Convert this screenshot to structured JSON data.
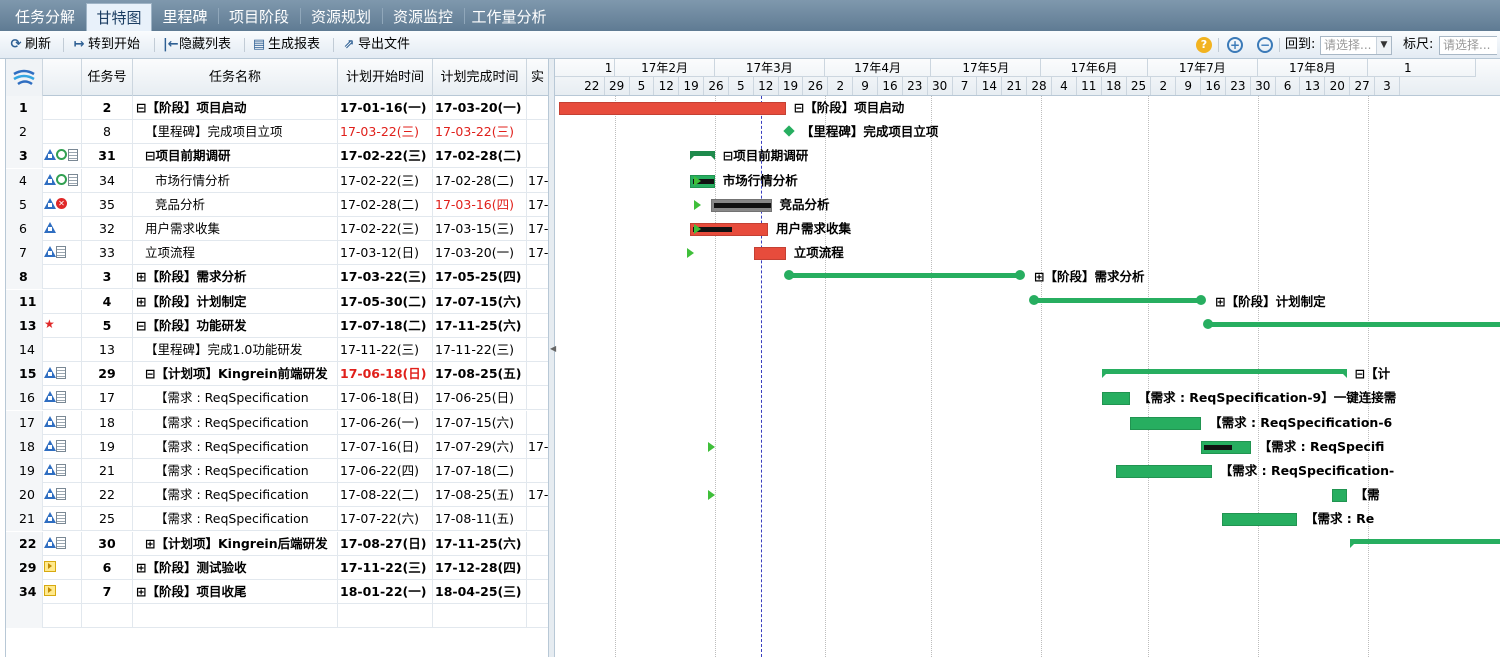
{
  "tabs": [
    "任务分解",
    "甘特图",
    "里程碑",
    "项目阶段",
    "资源规划",
    "资源监控",
    "工作量分析"
  ],
  "toolbar": {
    "refresh": "刷新",
    "goto_start": "转到开始",
    "hide_list": "隐藏列表",
    "gen_report": "生成报表",
    "export": "导出文件",
    "revert_label": "回到:",
    "revert_placeholder": "请选择...",
    "ruler_label": "标尺:",
    "ruler_placeholder": "请选择..."
  },
  "grid": {
    "columns": [
      "任务号",
      "任务名称",
      "计划开始时间",
      "计划完成时间",
      "实"
    ],
    "rows": [
      {
        "row": "1",
        "icons": [],
        "task_no": "2",
        "name": "⊟【阶段】项目启动",
        "start": "17-01-16(一)",
        "end": "17-03-20(一)",
        "actual": "",
        "bold": true,
        "indent": 0,
        "start_red": false,
        "end_red": false
      },
      {
        "row": "2",
        "icons": [],
        "task_no": "8",
        "name": "【里程碑】完成项目立项",
        "start": "17-03-22(三)",
        "end": "17-03-22(三)",
        "actual": "",
        "bold": false,
        "indent": 1,
        "start_red": true,
        "end_red": true
      },
      {
        "row": "3",
        "icons": [
          "a",
          "c",
          "d"
        ],
        "task_no": "31",
        "name": "⊟项目前期调研",
        "start": "17-02-22(三)",
        "end": "17-02-28(二)",
        "actual": "",
        "bold": true,
        "indent": 1,
        "start_red": false,
        "end_red": false
      },
      {
        "row": "4",
        "icons": [
          "a",
          "c",
          "d"
        ],
        "task_no": "34",
        "name": "市场行情分析",
        "start": "17-02-22(三)",
        "end": "17-02-28(二)",
        "actual": "17-",
        "bold": false,
        "indent": 2,
        "start_red": false,
        "end_red": false
      },
      {
        "row": "5",
        "icons": [
          "a",
          "x"
        ],
        "task_no": "35",
        "name": "竞品分析",
        "start": "17-02-28(二)",
        "end": "17-03-16(四)",
        "actual": "17-",
        "bold": false,
        "indent": 2,
        "start_red": false,
        "end_red": true
      },
      {
        "row": "6",
        "icons": [
          "a"
        ],
        "task_no": "32",
        "name": "用户需求收集",
        "start": "17-02-22(三)",
        "end": "17-03-15(三)",
        "actual": "17-",
        "bold": false,
        "indent": 1,
        "start_red": false,
        "end_red": false
      },
      {
        "row": "7",
        "icons": [
          "a",
          "d"
        ],
        "task_no": "33",
        "name": "立项流程",
        "start": "17-03-12(日)",
        "end": "17-03-20(一)",
        "actual": "17-",
        "bold": false,
        "indent": 1,
        "start_red": false,
        "end_red": false
      },
      {
        "row": "8",
        "icons": [],
        "task_no": "3",
        "name": "⊞【阶段】需求分析",
        "start": "17-03-22(三)",
        "end": "17-05-25(四)",
        "actual": "",
        "bold": true,
        "indent": 0,
        "start_red": false,
        "end_red": false
      },
      {
        "row": "11",
        "icons": [],
        "task_no": "4",
        "name": "⊞【阶段】计划制定",
        "start": "17-05-30(二)",
        "end": "17-07-15(六)",
        "actual": "",
        "bold": true,
        "indent": 0,
        "start_red": false,
        "end_red": false
      },
      {
        "row": "13",
        "icons": [
          "s"
        ],
        "task_no": "5",
        "name": "⊟【阶段】功能研发",
        "start": "17-07-18(二)",
        "end": "17-11-25(六)",
        "actual": "",
        "bold": true,
        "indent": 0,
        "start_red": false,
        "end_red": false
      },
      {
        "row": "14",
        "icons": [],
        "task_no": "13",
        "name": "【里程碑】完成1.0功能研发",
        "start": "17-11-22(三)",
        "end": "17-11-22(三)",
        "actual": "",
        "bold": false,
        "indent": 1,
        "start_red": false,
        "end_red": false
      },
      {
        "row": "15",
        "icons": [
          "a",
          "d"
        ],
        "task_no": "29",
        "name": "⊟【计划项】Kingrein前端研发",
        "start": "17-06-18(日)",
        "end": "17-08-25(五)",
        "actual": "",
        "bold": true,
        "indent": 1,
        "start_red": true,
        "end_red": false
      },
      {
        "row": "16",
        "icons": [
          "a",
          "d"
        ],
        "task_no": "17",
        "name": "【需求 : ReqSpecification",
        "start": "17-06-18(日)",
        "end": "17-06-25(日)",
        "actual": "",
        "bold": false,
        "indent": 2,
        "start_red": false,
        "end_red": false
      },
      {
        "row": "17",
        "icons": [
          "a",
          "d"
        ],
        "task_no": "18",
        "name": "【需求 : ReqSpecification",
        "start": "17-06-26(一)",
        "end": "17-07-15(六)",
        "actual": "",
        "bold": false,
        "indent": 2,
        "start_red": false,
        "end_red": false
      },
      {
        "row": "18",
        "icons": [
          "a",
          "d"
        ],
        "task_no": "19",
        "name": "【需求 : ReqSpecification",
        "start": "17-07-16(日)",
        "end": "17-07-29(六)",
        "actual": "17-",
        "bold": false,
        "indent": 2,
        "start_red": false,
        "end_red": false
      },
      {
        "row": "19",
        "icons": [
          "a",
          "d"
        ],
        "task_no": "21",
        "name": "【需求 : ReqSpecification",
        "start": "17-06-22(四)",
        "end": "17-07-18(二)",
        "actual": "",
        "bold": false,
        "indent": 2,
        "start_red": false,
        "end_red": false
      },
      {
        "row": "20",
        "icons": [
          "a",
          "d"
        ],
        "task_no": "22",
        "name": "【需求 : ReqSpecification",
        "start": "17-08-22(二)",
        "end": "17-08-25(五)",
        "actual": "17-",
        "bold": false,
        "indent": 2,
        "start_red": false,
        "end_red": false
      },
      {
        "row": "21",
        "icons": [
          "a",
          "d"
        ],
        "task_no": "25",
        "name": "【需求 : ReqSpecification",
        "start": "17-07-22(六)",
        "end": "17-08-11(五)",
        "actual": "",
        "bold": false,
        "indent": 2,
        "start_red": false,
        "end_red": false
      },
      {
        "row": "22",
        "icons": [
          "a",
          "d"
        ],
        "task_no": "30",
        "name": "⊞【计划项】Kingrein后端研发",
        "start": "17-08-27(日)",
        "end": "17-11-25(六)",
        "actual": "",
        "bold": true,
        "indent": 1,
        "start_red": false,
        "end_red": false
      },
      {
        "row": "29",
        "icons": [
          "p"
        ],
        "task_no": "6",
        "name": "⊞【阶段】测试验收",
        "start": "17-11-22(三)",
        "end": "17-12-28(四)",
        "actual": "",
        "bold": true,
        "indent": 0,
        "start_red": false,
        "end_red": false
      },
      {
        "row": "34",
        "icons": [
          "p"
        ],
        "task_no": "7",
        "name": "⊞【阶段】项目收尾",
        "start": "18-01-22(一)",
        "end": "18-04-25(三)",
        "actual": "",
        "bold": true,
        "indent": 0,
        "start_red": false,
        "end_red": false
      }
    ]
  },
  "timeline": {
    "partial_first": "1",
    "months": [
      "17年2月",
      "17年3月",
      "17年4月",
      "17年5月",
      "17年6月",
      "17年7月",
      "17年8月",
      "1"
    ],
    "weeks": [
      "22",
      "29",
      "5",
      "12",
      "19",
      "26",
      "5",
      "12",
      "19",
      "26",
      "2",
      "9",
      "16",
      "23",
      "30",
      "7",
      "14",
      "21",
      "28",
      "4",
      "11",
      "18",
      "25",
      "2",
      "9",
      "16",
      "23",
      "30",
      "6",
      "13",
      "20",
      "27",
      "3"
    ],
    "today": "2017-03-14"
  },
  "gantt": [
    {
      "label": "⊟【阶段】项目启动",
      "type": "bar",
      "start": "2017-01-16",
      "end": "2017-03-20",
      "color": "#e74c3c",
      "row": 0
    },
    {
      "label": "【里程碑】完成项目立项",
      "type": "milestone",
      "start": "2017-03-22",
      "end": "2017-03-22",
      "color": "#27ae60",
      "row": 1
    },
    {
      "label": "⊟项目前期调研",
      "type": "summary",
      "start": "2017-02-22",
      "end": "2017-02-28",
      "color": "#1e8a4c",
      "row": 2
    },
    {
      "label": "市场行情分析",
      "type": "bar",
      "start": "2017-02-22",
      "end": "2017-02-28",
      "color": "#27ae60",
      "progress": 1,
      "row": 3
    },
    {
      "label": "竞品分析",
      "type": "bar",
      "start": "2017-02-28",
      "end": "2017-03-16",
      "color": "#888888",
      "progress": 1,
      "row": 4
    },
    {
      "label": "用户需求收集",
      "type": "bar",
      "start": "2017-02-22",
      "end": "2017-03-15",
      "color": "#e74c3c",
      "progress": 0.55,
      "row": 5
    },
    {
      "label": "立项流程",
      "type": "bar",
      "start": "2017-03-12",
      "end": "2017-03-20",
      "color": "#e74c3c",
      "row": 6
    },
    {
      "label": "⊞【阶段】需求分析",
      "type": "phase",
      "start": "2017-03-22",
      "end": "2017-05-25",
      "color": "#27ae60",
      "row": 7
    },
    {
      "label": "⊞【阶段】计划制定",
      "type": "phase",
      "start": "2017-05-30",
      "end": "2017-07-15",
      "color": "#27ae60",
      "row": 8
    },
    {
      "label": "",
      "type": "phase",
      "start": "2017-07-18",
      "end": "2017-11-25",
      "color": "#27ae60",
      "row": 9
    },
    {
      "label": "⊟【计",
      "type": "summary",
      "start": "2017-06-18",
      "end": "2017-08-25",
      "color": "#27ae60",
      "row": 11
    },
    {
      "label": "【需求 : ReqSpecification-9】一键连接需",
      "type": "bar",
      "start": "2017-06-18",
      "end": "2017-06-25",
      "color": "#27ae60",
      "row": 12
    },
    {
      "label": "【需求 : ReqSpecification-6",
      "type": "bar",
      "start": "2017-06-26",
      "end": "2017-07-15",
      "color": "#27ae60",
      "row": 13
    },
    {
      "label": "【需求 : ReqSpecifi",
      "type": "bar",
      "start": "2017-07-16",
      "end": "2017-07-29",
      "color": "#27ae60",
      "progress": 0.65,
      "row": 14
    },
    {
      "label": "【需求 : ReqSpecification-",
      "type": "bar",
      "start": "2017-06-22",
      "end": "2017-07-18",
      "color": "#27ae60",
      "row": 15
    },
    {
      "label": "【需",
      "type": "bar",
      "start": "2017-08-22",
      "end": "2017-08-25",
      "color": "#27ae60",
      "row": 16
    },
    {
      "label": "【需求 : Re",
      "type": "bar",
      "start": "2017-07-22",
      "end": "2017-08-11",
      "color": "#27ae60",
      "row": 17
    },
    {
      "label": "",
      "type": "summary",
      "start": "2017-08-27",
      "end": "2017-11-25",
      "color": "#27ae60",
      "row": 18
    }
  ],
  "start_markers": [
    {
      "row": 3,
      "date": "2017-02-24"
    },
    {
      "row": 4,
      "date": "2017-02-24"
    },
    {
      "row": 5,
      "date": "2017-02-24"
    },
    {
      "row": 6,
      "date": "2017-02-22"
    },
    {
      "row": 14,
      "date": "2017-02-28"
    },
    {
      "row": 16,
      "date": "2017-02-28"
    }
  ]
}
